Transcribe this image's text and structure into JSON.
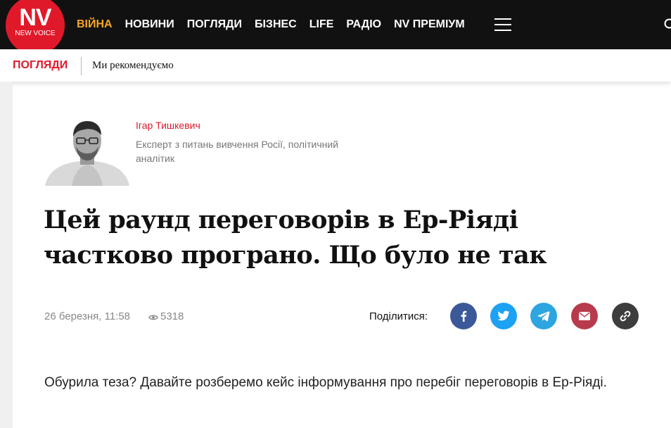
{
  "brand": {
    "logo_main": "NV",
    "logo_sub": "NEW VOICE",
    "accent": "#e0192a",
    "active_nav": "#f5a623"
  },
  "nav": {
    "items": [
      {
        "label": "ВІЙНА",
        "active": true
      },
      {
        "label": "НОВИНИ",
        "active": false
      },
      {
        "label": "ПОГЛЯДИ",
        "active": false
      },
      {
        "label": "БІЗНЕС",
        "active": false
      },
      {
        "label": "LIFE",
        "active": false
      },
      {
        "label": "РАДІО",
        "active": false
      },
      {
        "label": "NV ПРЕМІУМ",
        "active": false
      }
    ],
    "menu_icon": "hamburger-icon",
    "search_icon": "search-icon"
  },
  "subnav": {
    "section": "ПОГЛЯДИ",
    "link": "Ми рекомендуємо"
  },
  "author": {
    "name": "Ігар Тишкевич",
    "description": "Експерт з питань вивчення Росії, політичний аналітик"
  },
  "article": {
    "title": "Цей раунд переговорів в Ер-Ріяді частково програно. Що було не так",
    "date": "26 березня, 11:58",
    "views": "5318",
    "share_label": "Поділитися:",
    "share_buttons": [
      {
        "name": "facebook",
        "icon": "facebook-icon",
        "color": "#3b5998"
      },
      {
        "name": "twitter",
        "icon": "twitter-icon",
        "color": "#1da1f2"
      },
      {
        "name": "telegram",
        "icon": "telegram-icon",
        "color": "#2ca5e0"
      },
      {
        "name": "email",
        "icon": "mail-icon",
        "color": "#b73b4a"
      },
      {
        "name": "copy-link",
        "icon": "link-icon",
        "color": "#3d3d3d"
      }
    ],
    "body": "Обурила теза? Давайте розберемо кейс інформування про перебіг переговорів в Ер-Ріяді."
  }
}
